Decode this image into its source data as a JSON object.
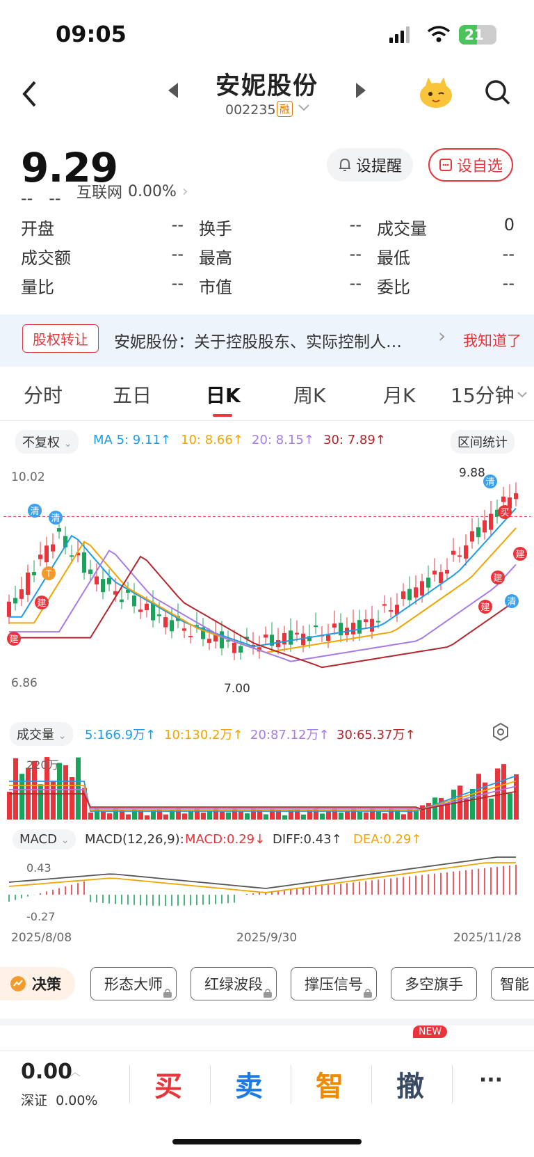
{
  "status": {
    "time": "09:05",
    "battery": "21"
  },
  "header": {
    "title": "安妮股份",
    "code": "002235",
    "tag": "融"
  },
  "quote": {
    "price": "9.29",
    "change": "--",
    "change_pct": "--",
    "sector": "互联网",
    "sector_pct": "0.00%",
    "alert_label": "设提醒",
    "watch_label": "设自选"
  },
  "stats": [
    [
      {
        "k": "开盘",
        "v": "--"
      },
      {
        "k": "换手",
        "v": "--"
      },
      {
        "k": "成交量",
        "v": "0"
      }
    ],
    [
      {
        "k": "成交额",
        "v": "--"
      },
      {
        "k": "最高",
        "v": "--"
      },
      {
        "k": "最低",
        "v": "--"
      }
    ],
    [
      {
        "k": "量比",
        "v": "--"
      },
      {
        "k": "市值",
        "v": "--"
      },
      {
        "k": "委比",
        "v": "--"
      }
    ]
  ],
  "notice": {
    "tag": "股权转让",
    "text": "安妮股份：关于控股股东、实际控制人…",
    "dismiss": "我知道了"
  },
  "tabs": [
    "分时",
    "五日",
    "日K",
    "周K",
    "月K",
    "15分钟"
  ],
  "ma_bar": {
    "adjust": "不复权",
    "ma5": "MA 5: 9.11↑",
    "ma10": "10: 8.66↑",
    "ma20": "20: 8.15↑",
    "ma30": "30: 7.89↑",
    "range_stats": "区间统计"
  },
  "kline": {
    "y_max_label": "10.02",
    "y_min_label": "6.86",
    "high_label": "9.88",
    "low_label": "7.00",
    "marks": {
      "qing": "清",
      "jian": "建",
      "mai": "买",
      "t": "T"
    }
  },
  "vol_bar": {
    "label": "成交量",
    "v5": "5:166.9万↑",
    "v10": "10:130.2万↑",
    "v20": "20:87.12万↑",
    "v30": "30:65.37万↑",
    "axis_label": "220万"
  },
  "macd_bar": {
    "label": "MACD",
    "params": "MACD(12,26,9):",
    "macd": "MACD:0.29↓",
    "diff": "DIFF:0.43↑",
    "dea": "DEA:0.29↑",
    "y_top": "0.43",
    "y_bottom": "-0.27"
  },
  "dates": [
    "2025/8/08",
    "2025/9/30",
    "2025/11/28"
  ],
  "tools": {
    "decision": "决策",
    "items": [
      "形态大师",
      "红绿波段",
      "撑压信号",
      "多空旗手",
      "智能"
    ]
  },
  "new_badge": "NEW",
  "bottom": {
    "value": "0.00",
    "market": "深证",
    "market_pct": "0.00%",
    "buy": "买",
    "sell": "卖",
    "smart": "智",
    "cancel": "撤",
    "more": "···"
  },
  "colors": {
    "up": "#e8343a",
    "down": "#1aa35a",
    "ma5": "#1e9be6",
    "ma10": "#f0a500",
    "ma20": "#a77be6",
    "ma30": "#b3262c"
  },
  "chart_data": {
    "type": "candlestick",
    "x_range": [
      "2025/8/08",
      "2025/11/28"
    ],
    "ylim": [
      6.86,
      10.02
    ],
    "high": 9.88,
    "low": 7.0,
    "last": 9.29
  }
}
